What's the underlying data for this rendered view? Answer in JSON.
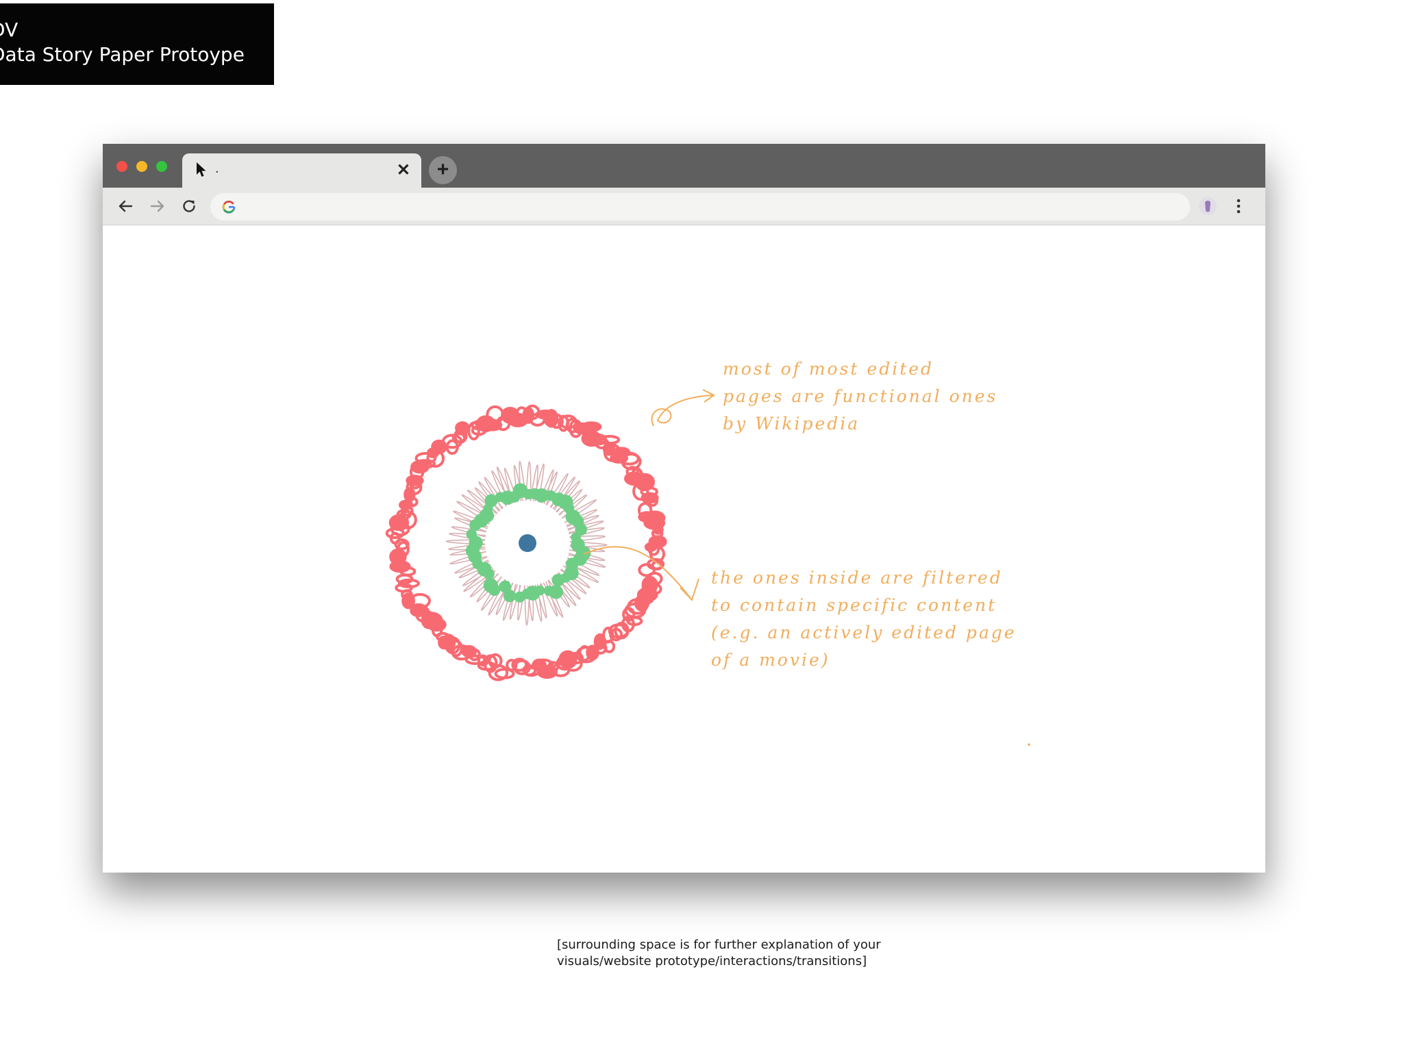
{
  "header": {
    "line1": "DV",
    "line2": "Data Story Paper Protoype"
  },
  "browser": {
    "tab": {
      "title": ".",
      "close_icon": "close-icon"
    },
    "new_tab_icon": "plus-icon",
    "nav": {
      "back_icon": "arrow-left-icon",
      "forward_icon": "arrow-right-icon",
      "reload_icon": "reload-icon",
      "omnibox_icon": "google-icon",
      "profile_icon": "profile-icon",
      "menu_icon": "kebab-menu-icon"
    },
    "window_controls": {
      "close": "#f2514a",
      "minimize": "#f6b828",
      "maximize": "#34c43d"
    }
  },
  "sketch": {
    "outer_ring_color": "#f86a72",
    "spoke_color": "#d8b0b2",
    "inner_ring_color": "#6fce86",
    "center_color": "#3f76a0",
    "annotation_color": "#f2ad5c",
    "annotation1": {
      "lines": [
        "most of most edited",
        "pages are functional ones",
        "by Wikipedia"
      ]
    },
    "annotation2": {
      "lines": [
        "the ones inside are filtered",
        "to contain specific content",
        "(e.g. an actively edited page",
        "of a movie)"
      ]
    }
  },
  "caption": {
    "line1": "[surrounding space is for further explanation of your",
    "line2": "visuals/website prototype/interactions/transitions]"
  }
}
